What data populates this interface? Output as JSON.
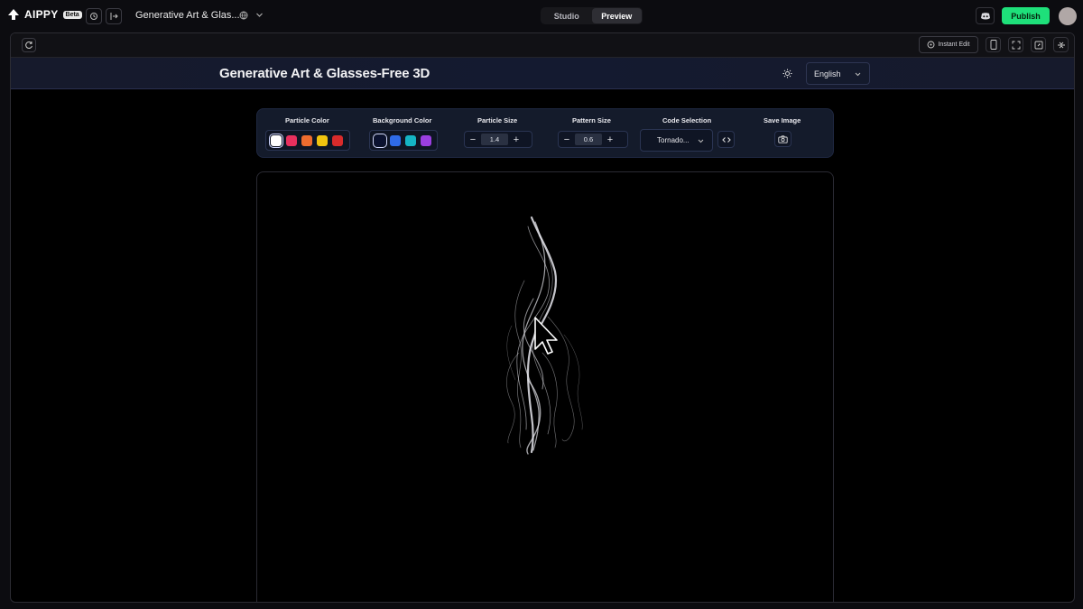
{
  "app": {
    "brand": "AIPPY",
    "badge": "Beta",
    "project_title": "Generative Art & Glas...",
    "modes": [
      "Studio",
      "Preview"
    ],
    "active_mode": "Preview",
    "publish_label": "Publish"
  },
  "frame_toolbar": {
    "instant_edit_label": "Instant Edit"
  },
  "site": {
    "title": "Generative Art & Glasses-Free 3D",
    "language": "English"
  },
  "controls": {
    "particle_color": {
      "label": "Particle Color",
      "swatches": [
        "#ffffff",
        "#e8305e",
        "#ef6c2e",
        "#f1c40f",
        "#d92b2b"
      ],
      "selected_index": 0
    },
    "background_color": {
      "label": "Background Color",
      "swatches": [
        "#0b1230",
        "#2f6be8",
        "#15b4c4",
        "#9b3fe0"
      ],
      "selected_index": 0
    },
    "particle_size": {
      "label": "Particle Size",
      "value": "1.4"
    },
    "pattern_size": {
      "label": "Pattern Size",
      "value": "0.6"
    },
    "code_selection": {
      "label": "Code Selection",
      "value": "Tornado..."
    },
    "save_image": {
      "label": "Save Image"
    }
  },
  "colors": {
    "publish": "#1ee07a",
    "panel": "#141b2b",
    "header": "#161a2c"
  }
}
